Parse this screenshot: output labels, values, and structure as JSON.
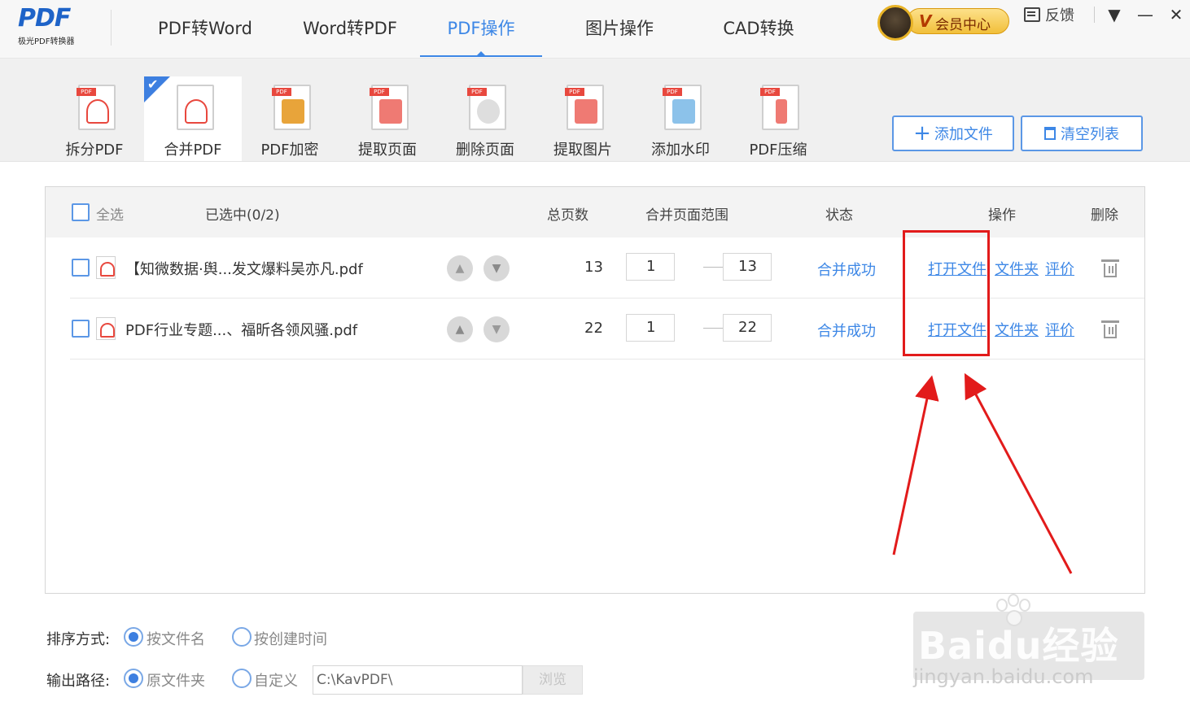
{
  "app": {
    "logo_text": "PDF",
    "logo_subtitle": "极光PDF转换器",
    "main_tabs": [
      {
        "label": "PDF转Word"
      },
      {
        "label": "Word转PDF"
      },
      {
        "label": "PDF操作",
        "active": true
      },
      {
        "label": "图片操作"
      },
      {
        "label": "CAD转换"
      }
    ],
    "vip_badge": "V",
    "vip_label": "会员中心",
    "feedback_label": "反馈",
    "window_controls": {
      "menu": "▼",
      "minimize": "—",
      "close": "✕"
    }
  },
  "tools": [
    {
      "label": "拆分PDF",
      "icon": "split-pdf-icon"
    },
    {
      "label": "合并PDF",
      "icon": "merge-pdf-icon",
      "active": true
    },
    {
      "label": "PDF加密",
      "icon": "encrypt-pdf-icon"
    },
    {
      "label": "提取页面",
      "icon": "extract-page-icon"
    },
    {
      "label": "删除页面",
      "icon": "delete-page-icon"
    },
    {
      "label": "提取图片",
      "icon": "extract-image-icon"
    },
    {
      "label": "添加水印",
      "icon": "watermark-icon"
    },
    {
      "label": "PDF压缩",
      "icon": "compress-pdf-icon"
    }
  ],
  "actions": {
    "add_file": {
      "label": "添加文件",
      "icon": "plus-icon"
    },
    "clear_list": {
      "label": "清空列表",
      "icon": "trash-icon"
    }
  },
  "table": {
    "headers": {
      "select_all": "全选",
      "selected": "已选中(0/2)",
      "total_pages": "总页数",
      "merge_range": "合并页面范围",
      "status": "状态",
      "operation": "操作",
      "delete": "删除"
    },
    "rows": [
      {
        "filename": "【知微数据·舆...发文爆料吴亦凡.pdf",
        "pages": "13",
        "range_from": "1",
        "range_to": "13",
        "status": "合并成功",
        "open_file": "打开文件",
        "folder": "文件夹",
        "rate": "评价"
      },
      {
        "filename": "PDF行业专题...、福昕各领风骚.pdf",
        "pages": "22",
        "range_from": "1",
        "range_to": "22",
        "status": "合并成功",
        "open_file": "打开文件",
        "folder": "文件夹",
        "rate": "评价"
      }
    ]
  },
  "options": {
    "sort_label": "排序方式:",
    "sort_by_name": "按文件名",
    "sort_by_time": "按创建时间",
    "output_label": "输出路径:",
    "output_original": "原文件夹",
    "output_custom": "自定义",
    "output_path": "C:\\KavPDF\\",
    "browse": "浏览"
  },
  "watermark": {
    "text": "Baidu经验",
    "url": "jingyan.baidu.com"
  },
  "colors": {
    "accent": "#3d87e6",
    "annotation": "#e21b1b",
    "vip_gold": "#f1bf3a"
  }
}
